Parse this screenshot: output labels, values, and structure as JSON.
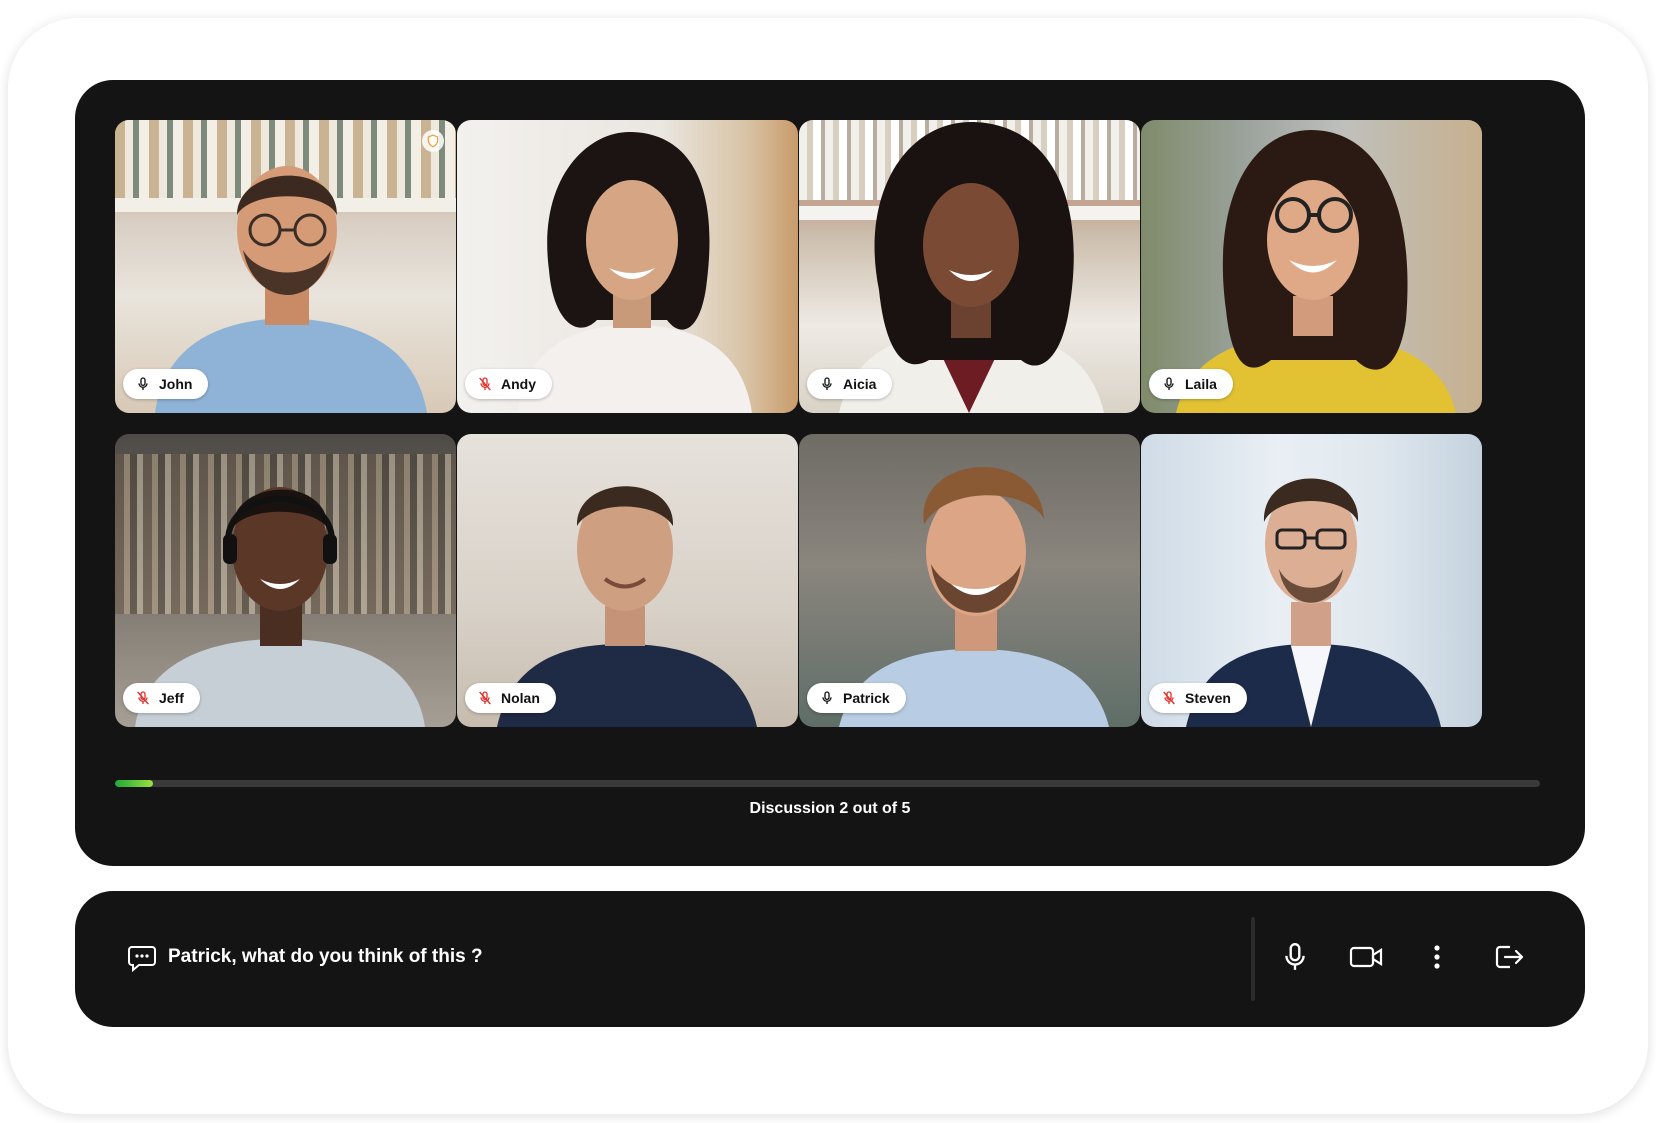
{
  "participants": [
    {
      "name": "John",
      "muted": false,
      "icon": "mic-icon"
    },
    {
      "name": "Andy",
      "muted": true,
      "icon": "mic-off-icon"
    },
    {
      "name": "Aicia",
      "muted": false,
      "icon": "mic-icon"
    },
    {
      "name": "Laila",
      "muted": false,
      "icon": "mic-icon"
    },
    {
      "name": "Jeff",
      "muted": true,
      "icon": "mic-off-icon"
    },
    {
      "name": "Nolan",
      "muted": true,
      "icon": "mic-off-icon"
    },
    {
      "name": "Patrick",
      "muted": false,
      "icon": "mic-icon"
    },
    {
      "name": "Steven",
      "muted": true,
      "icon": "mic-off-icon"
    }
  ],
  "badge": {
    "icon": "shield-icon",
    "color": "#e6a23c"
  },
  "progress": {
    "label": "Discussion 2 out of 5",
    "fraction": 0.027,
    "colors": [
      "#1fa83a",
      "#9be03a"
    ]
  },
  "control_bar": {
    "caption": "Patrick, what do you think of this ?",
    "caption_icon": "chat-bubble-icon",
    "buttons": [
      "mic-icon",
      "camera-icon",
      "more-vertical-icon",
      "leave-icon"
    ]
  },
  "colors": {
    "panel": "#141414",
    "muted_red": "#e0302a",
    "label_bg": "#ffffff"
  }
}
